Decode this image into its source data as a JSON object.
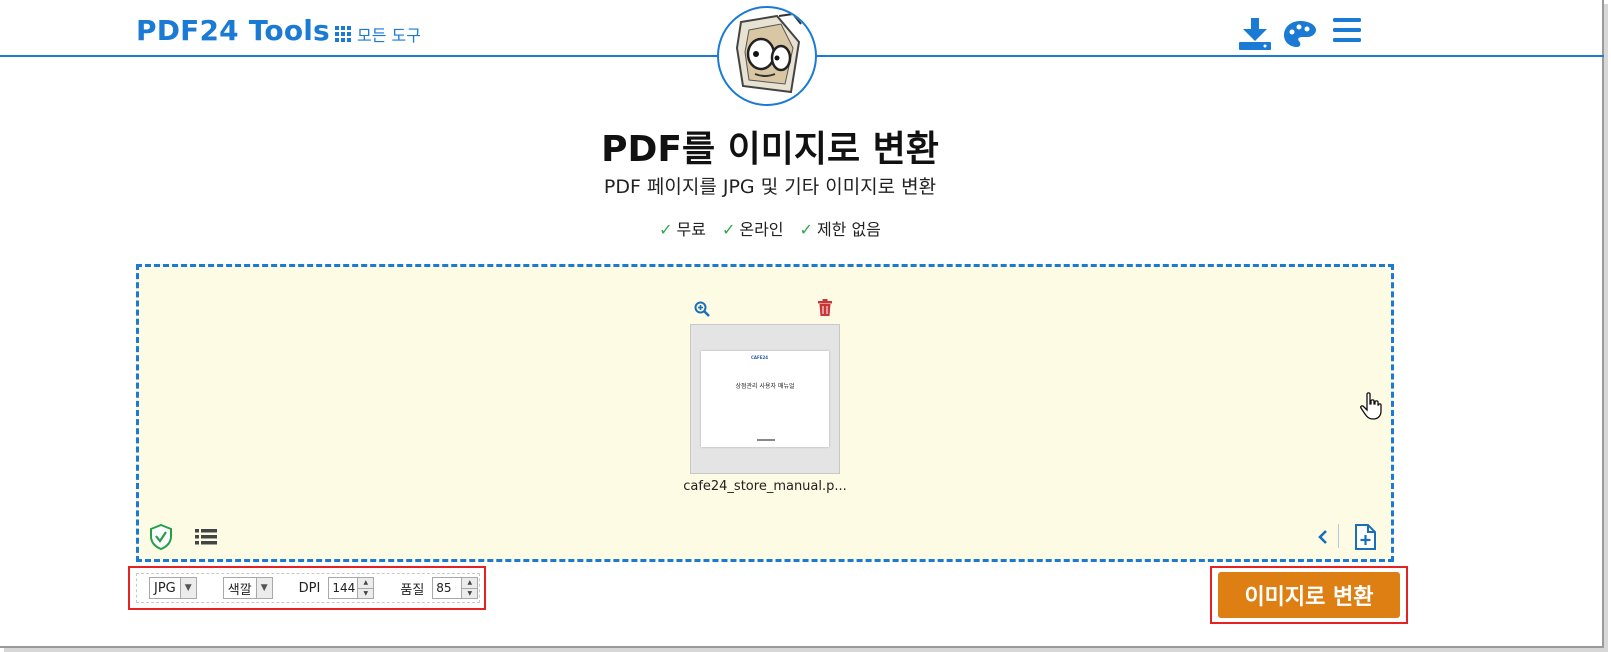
{
  "header": {
    "brand": "PDF24 Tools",
    "all_tools_label": "모든 도구",
    "icons": [
      "download-icon",
      "palette-icon",
      "menu-icon"
    ]
  },
  "hero": {
    "title": "PDF를 이미지로 변환",
    "subtitle": "PDF 페이지를 JPG 및 기타 이미지로 변환",
    "features": [
      {
        "check": "✓",
        "label": "무료"
      },
      {
        "check": "✓",
        "label": "온라인"
      },
      {
        "check": "✓",
        "label": "제한 없음"
      }
    ]
  },
  "dropzone": {
    "file": {
      "name": "cafe24_store_manual.p...",
      "preview_brand": "CAFE24",
      "preview_title": "상점관리 사용자 매뉴얼"
    }
  },
  "options": {
    "format": "JPG",
    "color": "색깔",
    "dpi_label": "DPI",
    "dpi_value": "144",
    "quality_label": "품질",
    "quality_value": "85"
  },
  "actions": {
    "convert_label": "이미지로 변환"
  },
  "colors": {
    "accent": "#1a7ad4",
    "convert": "#dd7f13",
    "dropzone_bg": "#fdfbe4",
    "highlight": "#e52222",
    "check": "#2ca84a",
    "trash": "#c9363a"
  }
}
